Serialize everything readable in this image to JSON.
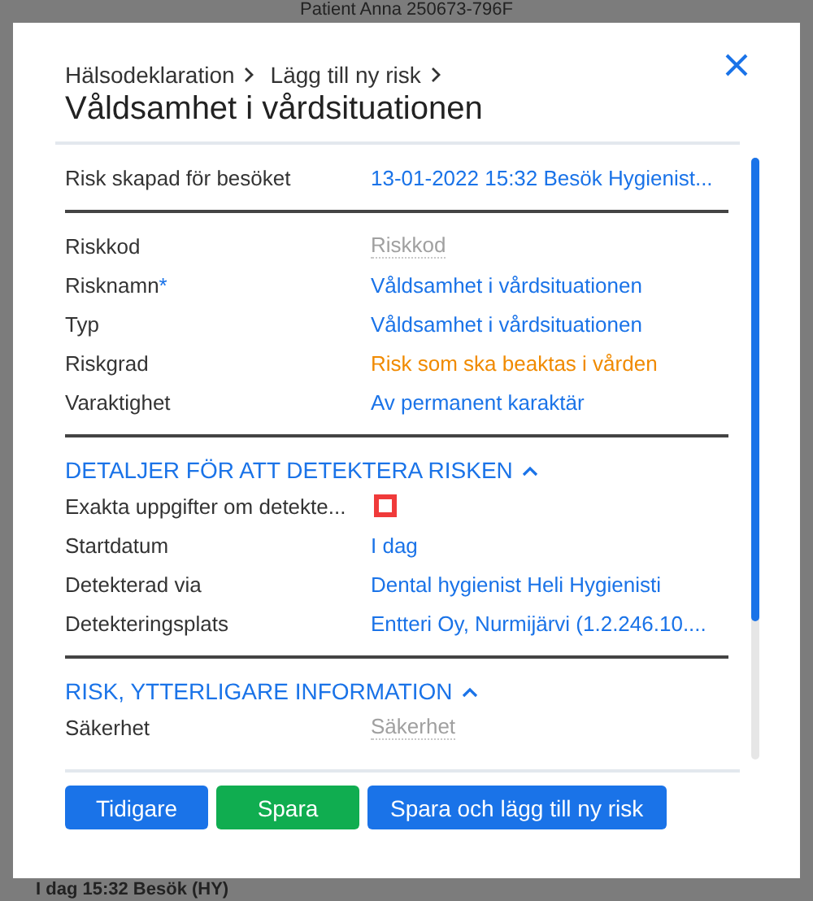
{
  "app": {
    "title": "Patient Anna 250673-796F",
    "footer_text": "I dag 15:32 Besök (HY)"
  },
  "dialog": {
    "breadcrumbs": [
      "Hälsodeklaration",
      "Lägg till ny risk"
    ],
    "title": "Våldsamhet i vårdsituationen",
    "sections": [
      {
        "rows": [
          {
            "label": "Risk skapad för besöket",
            "kind": "link",
            "value": "13-01-2022 15:32 Besök Hygienist..."
          }
        ]
      },
      {
        "rows": [
          {
            "label": "Riskkod",
            "kind": "placeholder",
            "value": "Riskkod"
          },
          {
            "label": "Risknamn",
            "marker": "*",
            "kind": "link",
            "value": "Våldsamhet i vårdsituationen"
          },
          {
            "label": "Typ",
            "kind": "link",
            "value": "Våldsamhet i vårdsituationen"
          },
          {
            "label": "Riskgrad",
            "kind": "warning",
            "value": "Risk som ska beaktas i vården"
          },
          {
            "label": "Varaktighet",
            "kind": "link",
            "value": "Av permanent karaktär"
          }
        ]
      },
      {
        "heading": "DETALJER FÖR ATT DETEKTERA RISKEN",
        "expanded": true,
        "rows": [
          {
            "label": "Exakta uppgifter om detekte...",
            "kind": "checkbox",
            "checked": false
          },
          {
            "label": "Startdatum",
            "kind": "link",
            "value": "I dag"
          },
          {
            "label": "Detekterad via",
            "kind": "link",
            "value": "Dental hygienist Heli Hygienisti"
          },
          {
            "label": "Detekteringsplats",
            "kind": "link",
            "value": "Entteri Oy, Nurmijärvi (1.2.246.10...."
          }
        ]
      },
      {
        "heading": "RISK, YTTERLIGARE INFORMATION",
        "expanded": true,
        "rows": [
          {
            "label": "Säkerhet",
            "kind": "placeholder",
            "value": "Säkerhet"
          }
        ]
      }
    ],
    "buttons": [
      {
        "label": "Tidigare",
        "kind": "primary"
      },
      {
        "label": "Spara",
        "kind": "success"
      },
      {
        "label": "Spara och lägg till ny risk",
        "kind": "primary"
      }
    ]
  }
}
